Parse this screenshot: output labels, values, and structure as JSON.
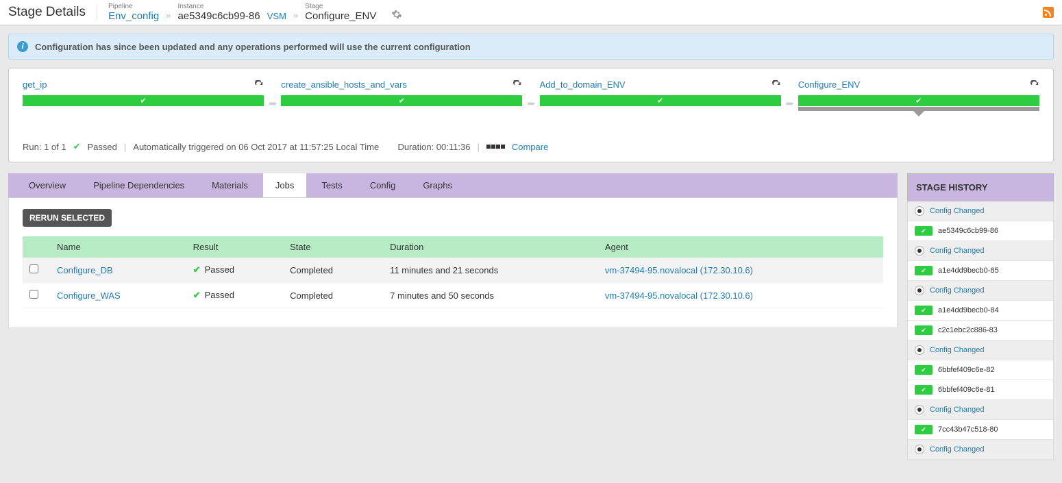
{
  "header": {
    "title": "Stage Details",
    "breadcrumb": {
      "pipeline_label": "Pipeline",
      "pipeline_value": "Env_config",
      "instance_label": "Instance",
      "instance_value": "ae5349c6cb99-86",
      "instance_vsm": "VSM",
      "stage_label": "Stage",
      "stage_value": "Configure_ENV"
    }
  },
  "info_banner": "Configuration has since been updated and any operations performed will use the current configuration",
  "stages": [
    {
      "name": "get_ip"
    },
    {
      "name": "create_ansible_hosts_and_vars"
    },
    {
      "name": "Add_to_domain_ENV"
    },
    {
      "name": "Configure_ENV",
      "active": true
    }
  ],
  "run_meta": {
    "run_text": "Run: 1 of 1",
    "status": "Passed",
    "trigger": "Automatically triggered on 06 Oct 2017 at 11:57:25 Local Time",
    "duration": "Duration: 00:11:36",
    "compare": "Compare"
  },
  "tabs": [
    "Overview",
    "Pipeline Dependencies",
    "Materials",
    "Jobs",
    "Tests",
    "Config",
    "Graphs"
  ],
  "active_tab": "Jobs",
  "rerun_button": "RERUN SELECTED",
  "jobs_table": {
    "headers": [
      "",
      "Name",
      "Result",
      "State",
      "Duration",
      "Agent"
    ],
    "rows": [
      {
        "name": "Configure_DB",
        "result": "Passed",
        "state": "Completed",
        "duration": "11 minutes and 21 seconds",
        "agent": "vm-37494-95.novalocal (172.30.10.6)"
      },
      {
        "name": "Configure_WAS",
        "result": "Passed",
        "state": "Completed",
        "duration": "7 minutes and 50 seconds",
        "agent": "vm-37494-95.novalocal (172.30.10.6)"
      }
    ]
  },
  "stage_history": {
    "title": "STAGE HISTORY",
    "items": [
      {
        "type": "config",
        "text": "Config Changed"
      },
      {
        "type": "run",
        "text": "ae5349c6cb99-86"
      },
      {
        "type": "config",
        "text": "Config Changed"
      },
      {
        "type": "run",
        "text": "a1e4dd9becb0-85"
      },
      {
        "type": "config",
        "text": "Config Changed"
      },
      {
        "type": "run",
        "text": "a1e4dd9becb0-84"
      },
      {
        "type": "run",
        "text": "c2c1ebc2c886-83"
      },
      {
        "type": "config",
        "text": "Config Changed"
      },
      {
        "type": "run",
        "text": "6bbfef409c6e-82"
      },
      {
        "type": "run",
        "text": "6bbfef409c6e-81"
      },
      {
        "type": "config",
        "text": "Config Changed"
      },
      {
        "type": "run",
        "text": "7cc43b47c518-80"
      },
      {
        "type": "config",
        "text": "Config Changed"
      }
    ]
  }
}
